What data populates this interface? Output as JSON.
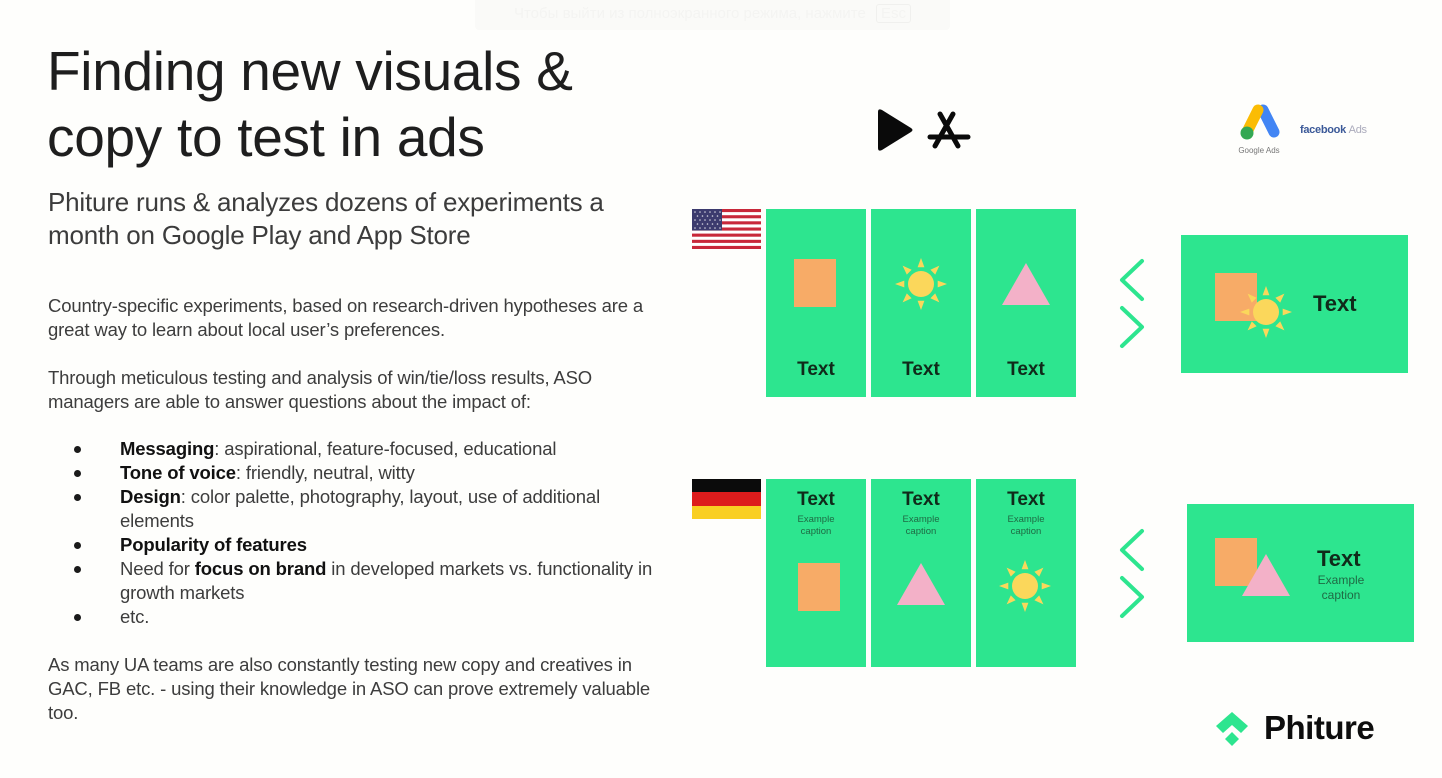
{
  "overlay": {
    "fullscreen_notice": "Чтобы выйти из полноэкранного режима, нажмите",
    "esc_key": "Esc"
  },
  "slide": {
    "title_line1": "Finding new visuals &",
    "title_line2": "copy to test in ads",
    "subtitle": "Phiture runs & analyzes dozens of experiments a month on Google Play and App Store",
    "paragraph1": "Country-specific experiments, based on research-driven hypotheses are a great way to learn about local user’s preferences.",
    "paragraph2": "Through meticulous testing and analysis of win/tie/loss results, ASO managers are able to answer questions about the impact of:",
    "bullets": [
      {
        "bold": "Messaging",
        "rest": ": aspirational, feature-focused, educational"
      },
      {
        "bold": "Tone of voice",
        "rest": ": friendly, neutral, witty"
      },
      {
        "bold": "Design",
        "rest": ": color palette, photography, layout, use of additional elements"
      },
      {
        "bold": "Popularity of features",
        "rest": ""
      },
      {
        "pre": "Need for ",
        "bold": "focus on brand",
        "rest": " in developed markets vs. functionality in growth markets"
      },
      {
        "bold": "",
        "rest": "etc."
      }
    ],
    "paragraph3": "As many UA teams are also constantly testing new copy and creatives in GAC, FB etc. - using their knowledge in ASO can prove extremely valuable too."
  },
  "illustration": {
    "store_icons": [
      "google-play-icon",
      "app-store-icon"
    ],
    "ad_platforms": {
      "google_ads_label": "Google Ads",
      "facebook_label": "facebook",
      "facebook_suffix": "Ads"
    },
    "rows": [
      {
        "country": "United States",
        "flag": "us-flag-icon",
        "cards": [
          {
            "shape": "square",
            "label": "Text"
          },
          {
            "shape": "sun",
            "label": "Text"
          },
          {
            "shape": "triangle",
            "label": "Text"
          }
        ],
        "ad": {
          "shapes": [
            "square",
            "sun"
          ],
          "label": "Text"
        }
      },
      {
        "country": "Germany",
        "flag": "de-flag-icon",
        "cards": [
          {
            "shape": "square",
            "label": "Text",
            "caption": "Example caption"
          },
          {
            "shape": "triangle",
            "label": "Text",
            "caption": "Example caption"
          },
          {
            "shape": "sun",
            "label": "Text",
            "caption": "Example caption"
          }
        ],
        "ad": {
          "shapes": [
            "square",
            "triangle"
          ],
          "label": "Text",
          "caption": "Example caption"
        }
      }
    ],
    "colors": {
      "card_green": "#2de58f",
      "square_orange": "#f7ab67",
      "sun_yellow": "#fbd75b",
      "triangle_pink": "#f3b1c8",
      "chevron_green": "#2de58f"
    }
  },
  "brand": {
    "name": "Phiture",
    "logo_color": "#2de58f"
  }
}
